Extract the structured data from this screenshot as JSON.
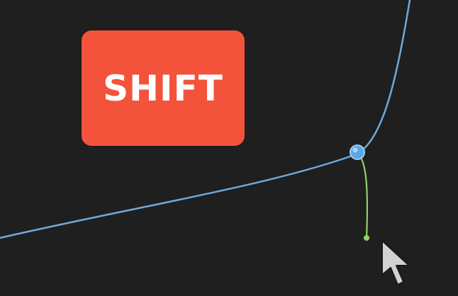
{
  "overlay": {
    "key_label": "SHIFT",
    "key_color": "#f3533a"
  },
  "canvas": {
    "background": "#1f1f1f",
    "curve_color": "#6fa8dc",
    "handle_color": "#8fd16a",
    "anchor_color": "#5aa8e6"
  },
  "cursor": {
    "icon": "arrow-pointer-icon"
  }
}
